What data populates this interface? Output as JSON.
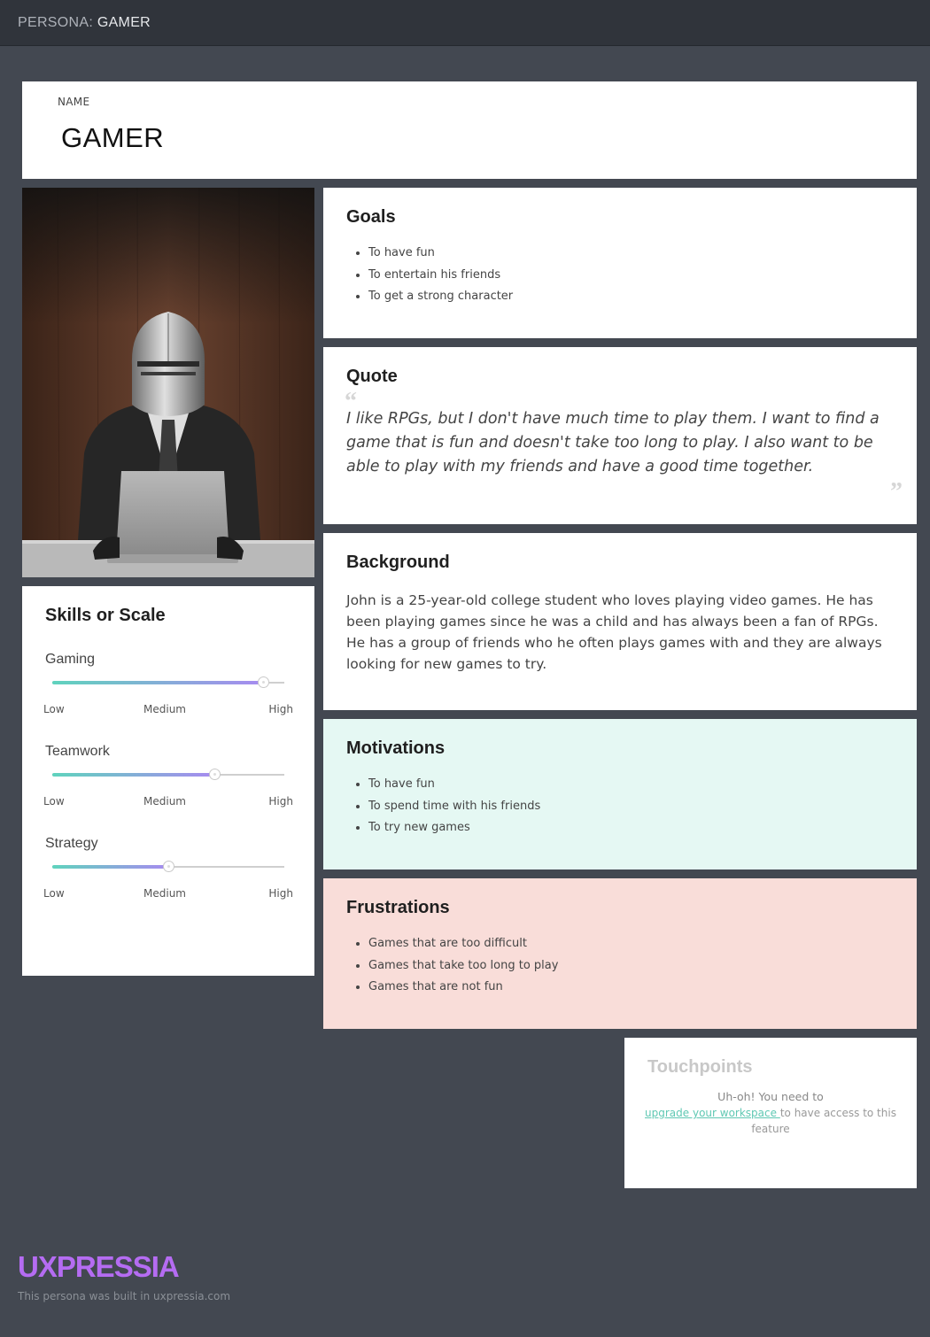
{
  "header": {
    "prefix": "PERSONA:",
    "persona": "GAMER"
  },
  "name_card": {
    "label": "NAME",
    "value": "GAMER"
  },
  "photo": {
    "description_icon": "knight-helmet-businessman-photo"
  },
  "skills": {
    "title": "Skills or Scale",
    "scale": {
      "low": "Low",
      "medium": "Medium",
      "high": "High"
    },
    "items": [
      {
        "name": "Gaming",
        "level_fraction": 0.91
      },
      {
        "name": "Teamwork",
        "level_fraction": 0.7
      },
      {
        "name": "Strategy",
        "level_fraction": 0.5
      }
    ]
  },
  "goals": {
    "title": "Goals",
    "items": [
      "To have fun",
      "To entertain his friends",
      "To get a strong character"
    ]
  },
  "quote": {
    "title": "Quote",
    "text": "I like RPGs, but I don't have much time to play them. I want to find a game that is fun and doesn't take too long to play. I also want to be able to play with my friends and have a good time together."
  },
  "background": {
    "title": "Background",
    "text": "John is a 25-year-old college student who loves playing video games. He has been playing games since he was a child and has always been a fan of RPGs. He has a group of friends who he often plays games with and they are always looking for new games to try."
  },
  "motivations": {
    "title": "Motivations",
    "items": [
      "To have fun",
      "To spend time with his friends",
      "To try new games"
    ]
  },
  "frustrations": {
    "title": "Frustrations",
    "items": [
      "Games that are too difficult",
      "Games that take too long to play",
      "Games that are not fun"
    ]
  },
  "touchpoints": {
    "title": "Touchpoints",
    "notice": "Uh-oh! You need to",
    "link": "upgrade your workspace ",
    "suffix": "to have access to this feature"
  },
  "footer": {
    "brand": "UXPRESSIA",
    "note": "This persona was built in uxpressia.com"
  },
  "colors": {
    "page_bg": "#434851",
    "motivations_bg": "#e5f8f3",
    "frustrations_bg": "#f9ddd9",
    "brand": "#b56cf2",
    "slider_start": "#5fd3bd",
    "slider_end": "#a78bf0"
  }
}
